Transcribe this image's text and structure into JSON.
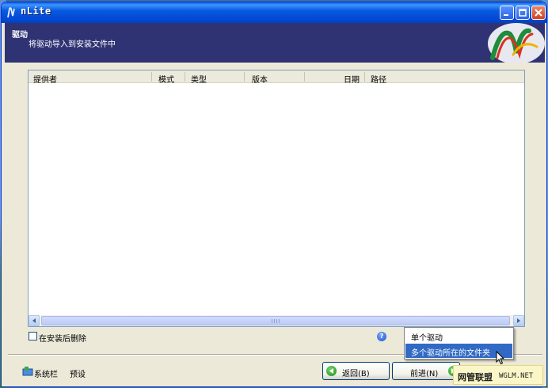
{
  "window": {
    "title": "nLite"
  },
  "banner": {
    "title": "驱动",
    "subtitle": "将驱动导入到安装文件中"
  },
  "driver_list": {
    "columns": [
      "提供者",
      "模式",
      "类型",
      "版本",
      "日期",
      "路径"
    ],
    "rows": []
  },
  "options": {
    "delete_after_install_label": "在安装后删除",
    "delete_after_install_checked": false
  },
  "footer": {
    "tray_label": "系统栏",
    "presets_label": "预设",
    "back_label": "返回(B)",
    "next_label": "前进(N)"
  },
  "insert_menu": {
    "items": [
      "单个驱动",
      "多个驱动所在的文件夹"
    ],
    "highlighted_index": 1
  },
  "watermark": {
    "cn": "网管联盟",
    "en": "WGLM.NET"
  },
  "colors": {
    "banner": "#2f3373",
    "titlebar": "#0249d6",
    "menu_highlight": "#316ac5"
  }
}
